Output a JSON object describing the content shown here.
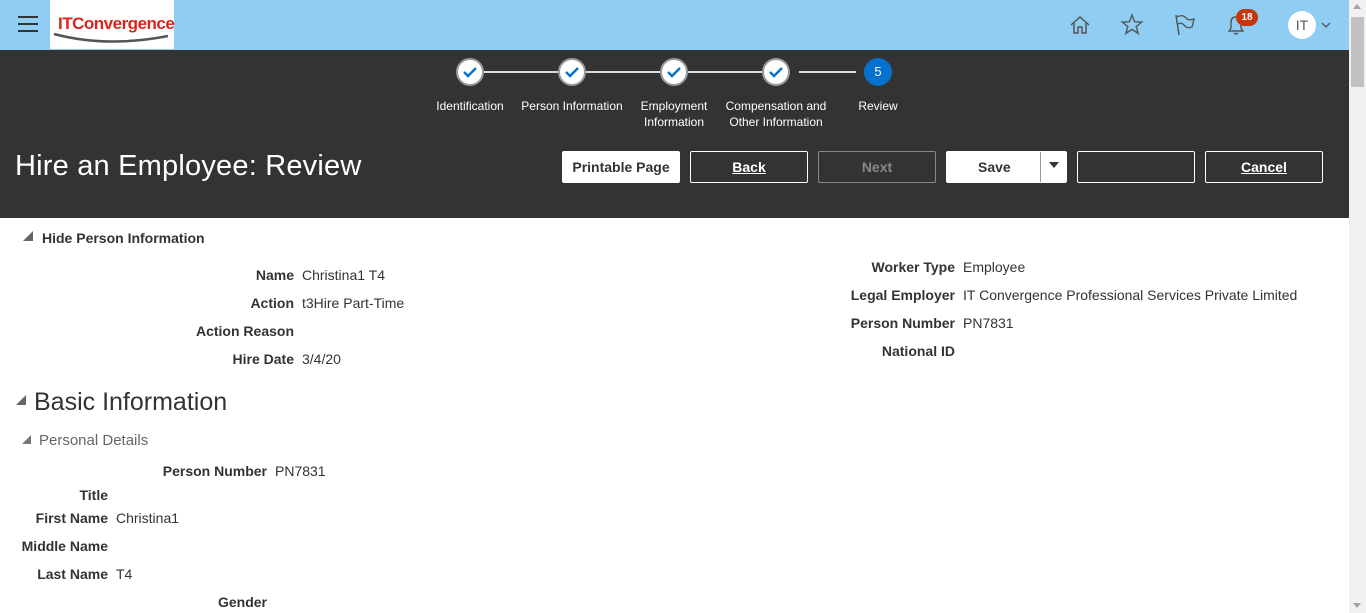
{
  "header": {
    "logo_text_it": "IT",
    "logo_text_conv": "Convergence",
    "notification_count": "18",
    "avatar_initials": "IT",
    "icons": [
      "menu-icon",
      "home-icon",
      "star-icon",
      "flag-icon",
      "bell-icon",
      "chevron-down-icon"
    ]
  },
  "train": {
    "steps": [
      {
        "label_line1": "Identification",
        "label_line2": "",
        "state": "complete"
      },
      {
        "label_line1": "Person Information",
        "label_line2": "",
        "state": "complete"
      },
      {
        "label_line1": "Employment",
        "label_line2": "Information",
        "state": "complete"
      },
      {
        "label_line1": "Compensation and",
        "label_line2": "Other Information",
        "state": "complete"
      },
      {
        "label_line1": "Review",
        "label_line2": "",
        "state": "current",
        "number": "5"
      }
    ]
  },
  "page": {
    "title": "Hire an Employee: Review"
  },
  "toolbar": {
    "printable_label": "Printable Page",
    "back_label": "Back",
    "next_label": "Next",
    "save_label": "Save",
    "blank_label": "",
    "cancel_label": "Cancel"
  },
  "person_info": {
    "toggle_label": "Hide Person Information",
    "left": [
      {
        "label": "Name",
        "value": "Christina1 T4"
      },
      {
        "label": "Action",
        "value": "t3Hire Part-Time"
      },
      {
        "label": "Action Reason",
        "value": ""
      },
      {
        "label": "Hire Date",
        "value": "3/4/20"
      }
    ],
    "right": [
      {
        "label": "Worker Type",
        "value": "Employee"
      },
      {
        "label": "Legal Employer",
        "value": "IT Convergence Professional Services Private Limited"
      },
      {
        "label": "Person Number",
        "value": "PN7831"
      },
      {
        "label": "National ID",
        "value": ""
      }
    ]
  },
  "basic_info": {
    "title": "Basic Information",
    "personal_details_title": "Personal Details",
    "person_number_label": "Person Number",
    "person_number_value": "PN7831",
    "fields": [
      {
        "label": "Title",
        "value": ""
      },
      {
        "label": "First Name",
        "value": "Christina1"
      },
      {
        "label": "Middle Name",
        "value": ""
      },
      {
        "label": "Last Name",
        "value": "T4"
      }
    ],
    "gender_label": "Gender"
  },
  "colors": {
    "header_bg": "#8fcdf3",
    "band_bg": "#333333",
    "accent": "#0572ce",
    "badge": "#c2380a"
  }
}
